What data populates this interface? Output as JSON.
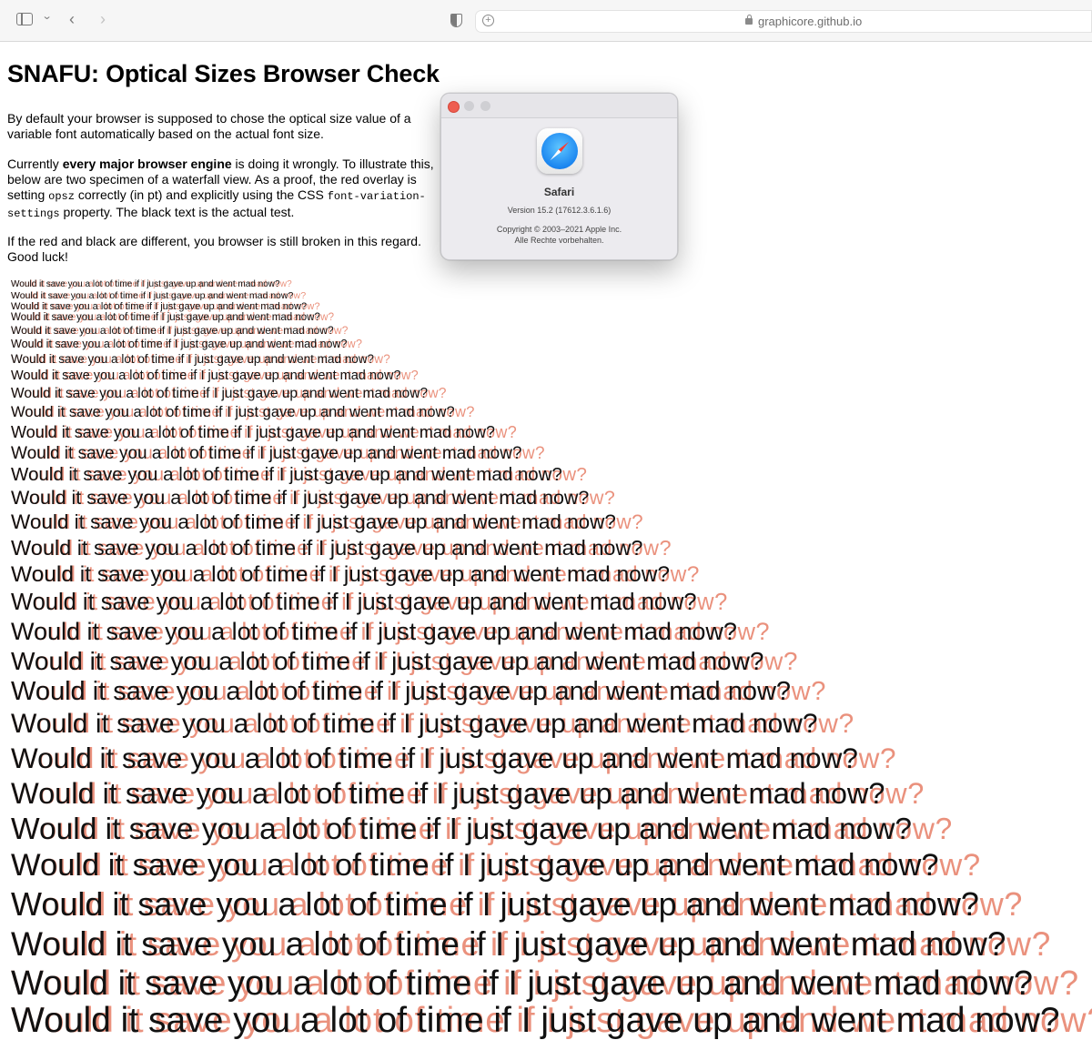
{
  "browser": {
    "url": "graphicore.github.io",
    "back_glyph": "‹",
    "forward_glyph": "›",
    "sidebar_chevron": "⌄",
    "add_glyph": "+"
  },
  "page": {
    "title": "SNAFU: Optical Sizes Browser Check",
    "p1": "By default your browser is supposed to chose the optical size value of a variable font automatically based on the actual font size.",
    "p2_a": "Currently ",
    "p2_bold": "every major browser engine",
    "p2_b": " is doing it wrongly. To illustrate this, below are two specimen of a waterfall view. As a proof, the red overlay is setting ",
    "p2_code1": "opsz",
    "p2_c": " correctly (in pt) and explicitly using the CSS ",
    "p2_code2": "font-variation-settings",
    "p2_d": " property. The black text is the actual test.",
    "p3": "If the red and black are different, you browser is still broken in this regard. Good luck!"
  },
  "waterfall": {
    "text": "Would it save you a lot of time if I just gave up and went mad now?",
    "red_color": "#e8866f",
    "black_color": "#111111"
  },
  "about_dialog": {
    "app_name": "Safari",
    "version": "Version 15.2 (17612.3.6.1.6)",
    "copyright": "Copyright © 2003–2021 Apple Inc.",
    "rights": "Alle Rechte vorbehalten."
  }
}
